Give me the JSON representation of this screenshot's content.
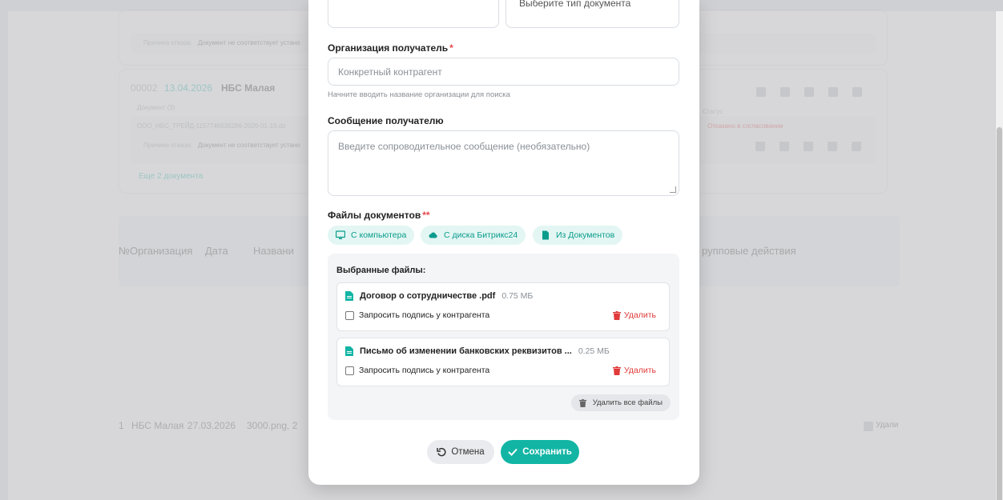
{
  "background": {
    "card1": {
      "reason_label": "Причина отказа:",
      "reason_text": "Документ не соответствует устано"
    },
    "card2": {
      "number": "00002",
      "date": "13.04.2026",
      "org": "НБС Малая",
      "doc_label": "Документ (3)",
      "doc_name": "ООО_НБС_ТРЕЙД-1157746536286-2026-01-19.do",
      "reason_label": "Причина отказа:",
      "reason_text": "Документ не соответствует устано",
      "more_link": "Еще 2 документа",
      "status_label": "Статус",
      "status_value": "Отказано в согласовании"
    },
    "table": {
      "headers": [
        "№",
        "Организация",
        "Дата",
        "Названи"
      ],
      "group_header": "рупповые действия",
      "row": {
        "num": "1",
        "org": "НБС Малая",
        "date": "27.03.2026",
        "name": "3000.png, 2"
      },
      "row_delete": "Удали"
    }
  },
  "modal": {
    "top_select_placeholder": "Выберите тип документа",
    "recipient_org": {
      "label": "Организация получатель",
      "required": "*",
      "placeholder": "Конкретный контрагент",
      "hint": "Начните вводить название организации для поиска"
    },
    "message": {
      "label": "Сообщение получателю",
      "placeholder": "Введите сопроводительное сообщение (необязательно)"
    },
    "files": {
      "label": "Файлы документов",
      "required": "**",
      "sources": [
        {
          "label": "С компьютера",
          "icon": "monitor-icon"
        },
        {
          "label": "С диска Битрикс24",
          "icon": "cloud-icon"
        },
        {
          "label": "Из Документов",
          "icon": "document-icon"
        }
      ],
      "selected_title": "Выбранные файлы:",
      "items": [
        {
          "name": "Договор о сотрудничестве .pdf",
          "size": "0.75 МБ",
          "sign_label": "Запросить подпись у контрагента",
          "delete_label": "Удалить"
        },
        {
          "name": "Письмо об изменении банковских реквизитов ...",
          "size": "0.25 МБ",
          "sign_label": "Запросить подпись у контрагента",
          "delete_label": "Удалить"
        }
      ],
      "delete_all_label": "Удалить все файлы"
    },
    "cancel_label": "Отмена",
    "save_label": "Сохранить"
  },
  "colors": {
    "accent": "#12b5a4",
    "danger": "#e03a3a",
    "required": "#e5484d"
  }
}
